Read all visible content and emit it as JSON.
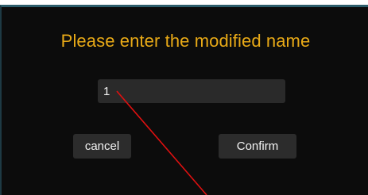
{
  "dialog": {
    "title": "Please enter the modified name",
    "title_color": "#e9aa17",
    "background": "#0c0c0c",
    "name_input": {
      "value": "1",
      "placeholder": ""
    },
    "cancel_label": "cancel",
    "confirm_label": "Confirm"
  },
  "annotation": {
    "line_color": "#e01010"
  }
}
